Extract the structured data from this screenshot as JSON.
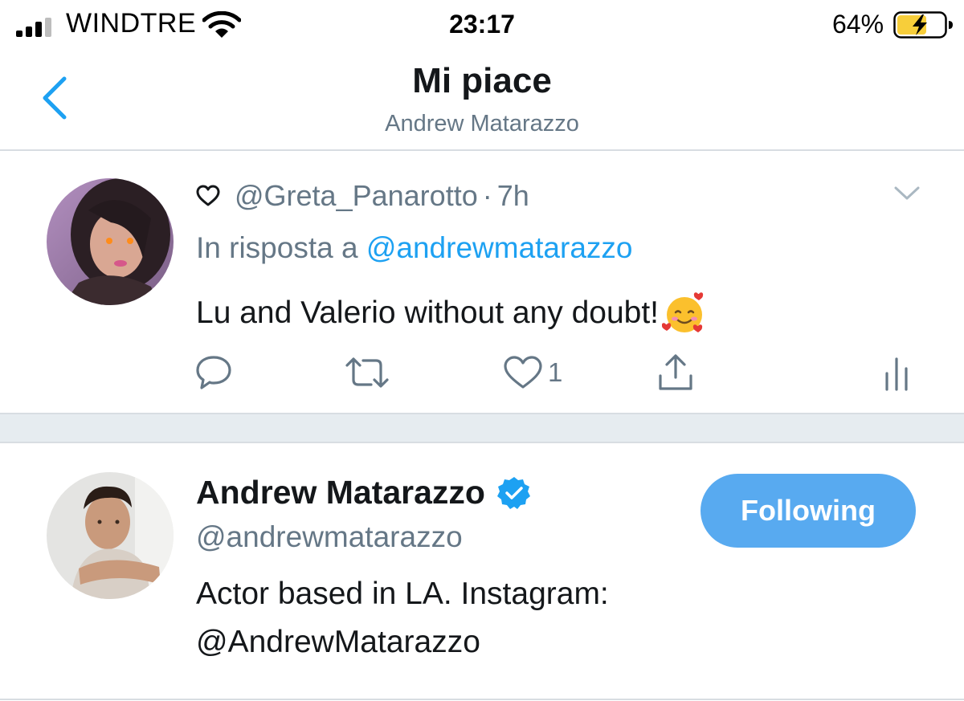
{
  "status_bar": {
    "carrier": "WINDTRE",
    "time": "23:17",
    "battery_percent": "64%",
    "battery_level": 0.64,
    "charging": true
  },
  "header": {
    "title": "Mi piace",
    "subtitle": "Andrew Matarazzo",
    "back_icon": "chevron-left-icon"
  },
  "tweet": {
    "handle": "@Greta_Panarotto",
    "separator": "·",
    "time": "7h",
    "reply_prefix": "In risposta a",
    "reply_to": "@andrewmatarazzo",
    "text": "Lu and Valerio without any doubt!",
    "emoji": "smiling-face-with-hearts",
    "like_count": "1",
    "icons": [
      "reply-icon",
      "retweet-icon",
      "like-icon",
      "share-icon",
      "analytics-icon",
      "chevron-down-icon"
    ]
  },
  "user": {
    "name": "Andrew Matarazzo",
    "handle": "@andrewmatarazzo",
    "bio_line1": "Actor based in LA. Instagram:",
    "bio_line2": "@AndrewMatarazzo",
    "follow_label": "Following",
    "verified": true
  },
  "colors": {
    "accent": "#1da1f2",
    "follow_button": "#58aaf0",
    "secondary_text": "#657786",
    "divider": "#d8dde2",
    "battery_fill": "#f7ce3a"
  }
}
